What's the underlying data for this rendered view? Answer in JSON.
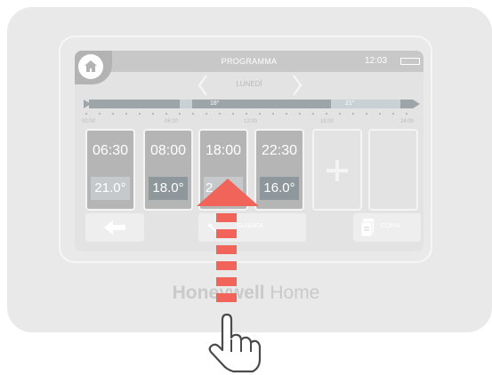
{
  "header": {
    "title": "PROGRAMMA",
    "clock": "12:03"
  },
  "day": "LUNEDÌ",
  "timeline": {
    "segments": [
      {
        "label": "18°"
      },
      {
        "label": "21°"
      }
    ],
    "ticks": [
      "00:00",
      "06:00",
      "12:00",
      "18:00",
      "24:00"
    ]
  },
  "slots": [
    {
      "time": "06:30",
      "temp": "21.0°"
    },
    {
      "time": "08:00",
      "temp": "18.0°"
    },
    {
      "time": "18:00",
      "temp": "2"
    },
    {
      "time": "22:30",
      "temp": "16.0°"
    }
  ],
  "buttons": {
    "guided": "GUIDATA",
    "copy": "COPIA"
  },
  "brand": {
    "bold": "Honeywell",
    "regular": "Home"
  },
  "colors": {
    "arrow": "#f0645a",
    "screen": "#e3e3e3",
    "slot": "#b5b5b5",
    "timeline": "#9ea5a9"
  },
  "icons": [
    "home-icon",
    "chevron-left-icon",
    "chevron-right-icon",
    "battery-icon",
    "plus-icon",
    "arrow-left-icon",
    "wrench-icon",
    "copy-icon",
    "hand-pointer-icon",
    "arrow-up-icon"
  ]
}
